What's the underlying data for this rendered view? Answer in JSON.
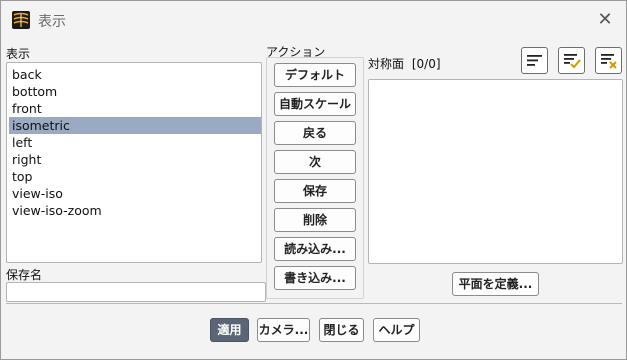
{
  "window": {
    "title": "表示"
  },
  "views": {
    "label": "表示",
    "items": [
      "back",
      "bottom",
      "front",
      "isometric",
      "left",
      "right",
      "top",
      "view-iso",
      "view-iso-zoom"
    ],
    "selected": "isometric"
  },
  "save_name": {
    "label": "保存名",
    "value": ""
  },
  "actions": {
    "label": "アクション",
    "buttons": [
      "デフォルト",
      "自動スケール",
      "戻る",
      "次",
      "保存",
      "削除",
      "読み込み...",
      "書き込み..."
    ]
  },
  "mirror_planes": {
    "label": "対称面",
    "count": "[0/0]",
    "items": [],
    "define_button": "平面を定義..."
  },
  "toolbar_icons": [
    "list-all-icon",
    "select-all-icon",
    "deselect-all-icon"
  ],
  "footer": {
    "buttons": [
      "適用",
      "カメラ...",
      "閉じる",
      "ヘルプ"
    ]
  },
  "colors": {
    "selection": "#99aac2",
    "primary_button": "#5a6676",
    "check_accent": "#d19a00",
    "clear_accent": "#d19a00"
  }
}
